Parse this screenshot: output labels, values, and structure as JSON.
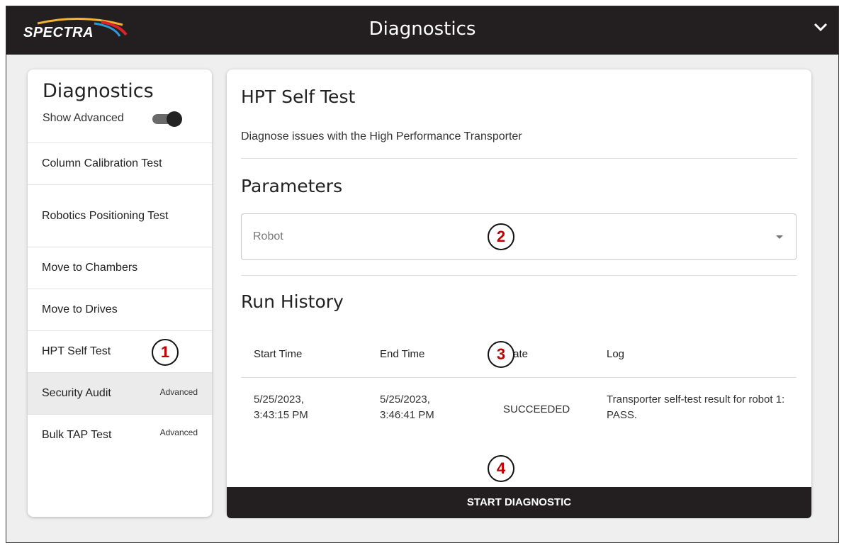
{
  "header": {
    "logo_text": "SPECTRA",
    "title": "Diagnostics",
    "menu_icon": "chevron-down-icon"
  },
  "sidebar": {
    "title": "Diagnostics",
    "show_advanced_label": "Show Advanced",
    "show_advanced_on": true,
    "items": [
      {
        "label": "Column Calibration Test",
        "badge": ""
      },
      {
        "label": "Robotics Positioning Test",
        "badge": ""
      },
      {
        "label": "Move to Chambers",
        "badge": ""
      },
      {
        "label": "Move to Drives",
        "badge": ""
      },
      {
        "label": "HPT Self Test",
        "badge": ""
      },
      {
        "label": "Security Audit",
        "badge": "Advanced"
      },
      {
        "label": "Bulk TAP Test",
        "badge": "Advanced"
      }
    ]
  },
  "main": {
    "title": "HPT Self Test",
    "description": "Diagnose issues with the High Performance Transporter",
    "parameters_heading": "Parameters",
    "robot_select_placeholder": "Robot",
    "history_heading": "Run History",
    "columns": [
      "Start Time",
      "End Time",
      "State",
      "Log"
    ],
    "rows": [
      {
        "start_time": "5/25/2023, 3:43:15 PM",
        "end_time": "5/25/2023, 3:46:41 PM",
        "state": "SUCCEEDED",
        "log": "Transporter self-test result for robot 1: PASS."
      }
    ],
    "start_button": "START DIAGNOSTIC"
  },
  "callouts": [
    "1",
    "2",
    "3",
    "4"
  ],
  "colors": {
    "header_bg": "#231f20",
    "callout_number": "#c00000",
    "page_bg": "#efefef"
  }
}
